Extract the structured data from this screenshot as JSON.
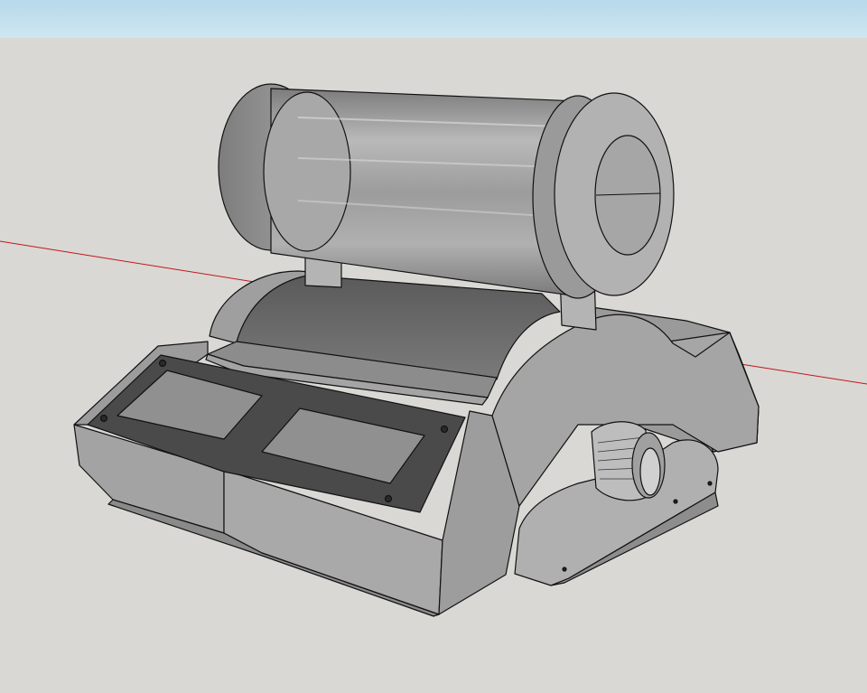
{
  "viewport": {
    "sky_color": "#c4e0ee",
    "ground_color": "#d9d8d4",
    "axis_red_color": "#c4161c"
  },
  "model": {
    "body_light": "#a9a9a9",
    "body_mid": "#8e8e8e",
    "body_dark": "#6e6e6e",
    "panel_color": "#4a4a4a",
    "screen_color": "#8f8f8f",
    "roller_color": "#a2a2a2",
    "edge_color": "#111111"
  }
}
